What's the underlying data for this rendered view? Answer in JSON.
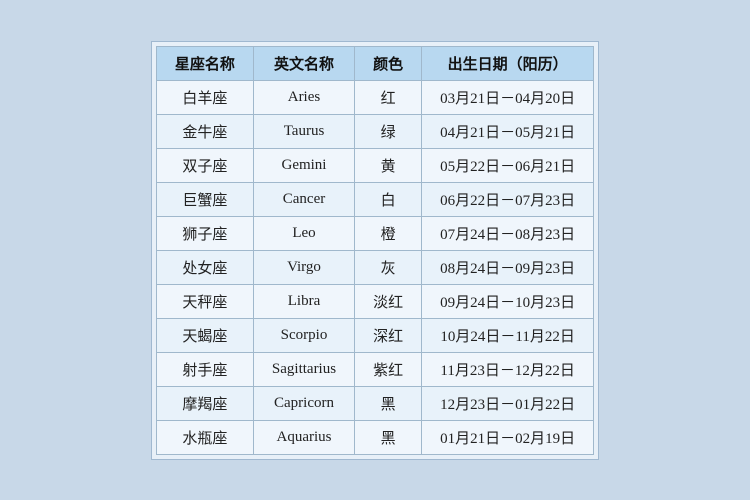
{
  "table": {
    "headers": [
      "星座名称",
      "英文名称",
      "颜色",
      "出生日期（阳历）"
    ],
    "rows": [
      [
        "白羊座",
        "Aries",
        "红",
        "03月21日－04月20日"
      ],
      [
        "金牛座",
        "Taurus",
        "绿",
        "04月21日－05月21日"
      ],
      [
        "双子座",
        "Gemini",
        "黄",
        "05月22日－06月21日"
      ],
      [
        "巨蟹座",
        "Cancer",
        "白",
        "06月22日－07月23日"
      ],
      [
        "狮子座",
        "Leo",
        "橙",
        "07月24日－08月23日"
      ],
      [
        "处女座",
        "Virgo",
        "灰",
        "08月24日－09月23日"
      ],
      [
        "天秤座",
        "Libra",
        "淡红",
        "09月24日－10月23日"
      ],
      [
        "天蝎座",
        "Scorpio",
        "深红",
        "10月24日－11月22日"
      ],
      [
        "射手座",
        "Sagittarius",
        "紫红",
        "11月23日－12月22日"
      ],
      [
        "摩羯座",
        "Capricorn",
        "黑",
        "12月23日－01月22日"
      ],
      [
        "水瓶座",
        "Aquarius",
        "黑",
        "01月21日－02月19日"
      ]
    ]
  }
}
